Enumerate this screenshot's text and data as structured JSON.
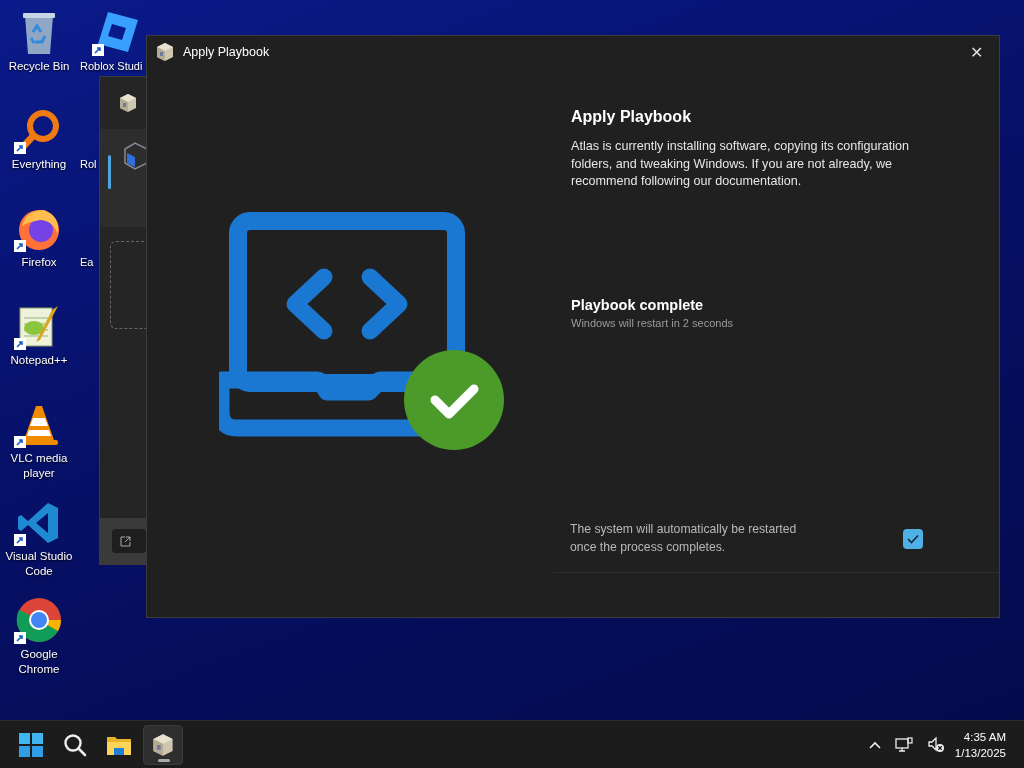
{
  "desktop": {
    "icons": [
      {
        "label": "Recycle Bin",
        "kind": "recycle"
      },
      {
        "label": "Everything",
        "kind": "everything"
      },
      {
        "label": "Firefox",
        "kind": "firefox"
      },
      {
        "label": "Notepad++",
        "kind": "notepad"
      },
      {
        "label": "VLC media player",
        "kind": "vlc"
      },
      {
        "label": "Visual Studio Code",
        "kind": "vscode"
      },
      {
        "label": "Google Chrome",
        "kind": "chrome"
      },
      {
        "label": "Roblox Studi",
        "kind": "roblox"
      },
      {
        "label": "Rol",
        "kind": "covered"
      },
      {
        "label": "Ea",
        "kind": "covered"
      }
    ]
  },
  "window": {
    "title": "Apply Playbook",
    "close_glyph": "✕",
    "heading": "Apply Playbook",
    "description": "Atlas is currently installing software, copying its configuration folders, and tweaking Windows. If you are not already, we recommend following our documentation.",
    "status": {
      "title": "Playbook complete",
      "detail": "Windows will restart in 2 seconds"
    },
    "restart_option": {
      "text": "The system will automatically be restarted once the process completes.",
      "checked": true
    }
  },
  "taskbar": {
    "apps": [
      {
        "kind": "start",
        "active": false
      },
      {
        "kind": "search",
        "active": false
      },
      {
        "kind": "explorer",
        "active": false
      },
      {
        "kind": "atlas",
        "active": true
      }
    ],
    "clock": {
      "time": "4:35 AM",
      "date": "1/13/2025"
    }
  }
}
